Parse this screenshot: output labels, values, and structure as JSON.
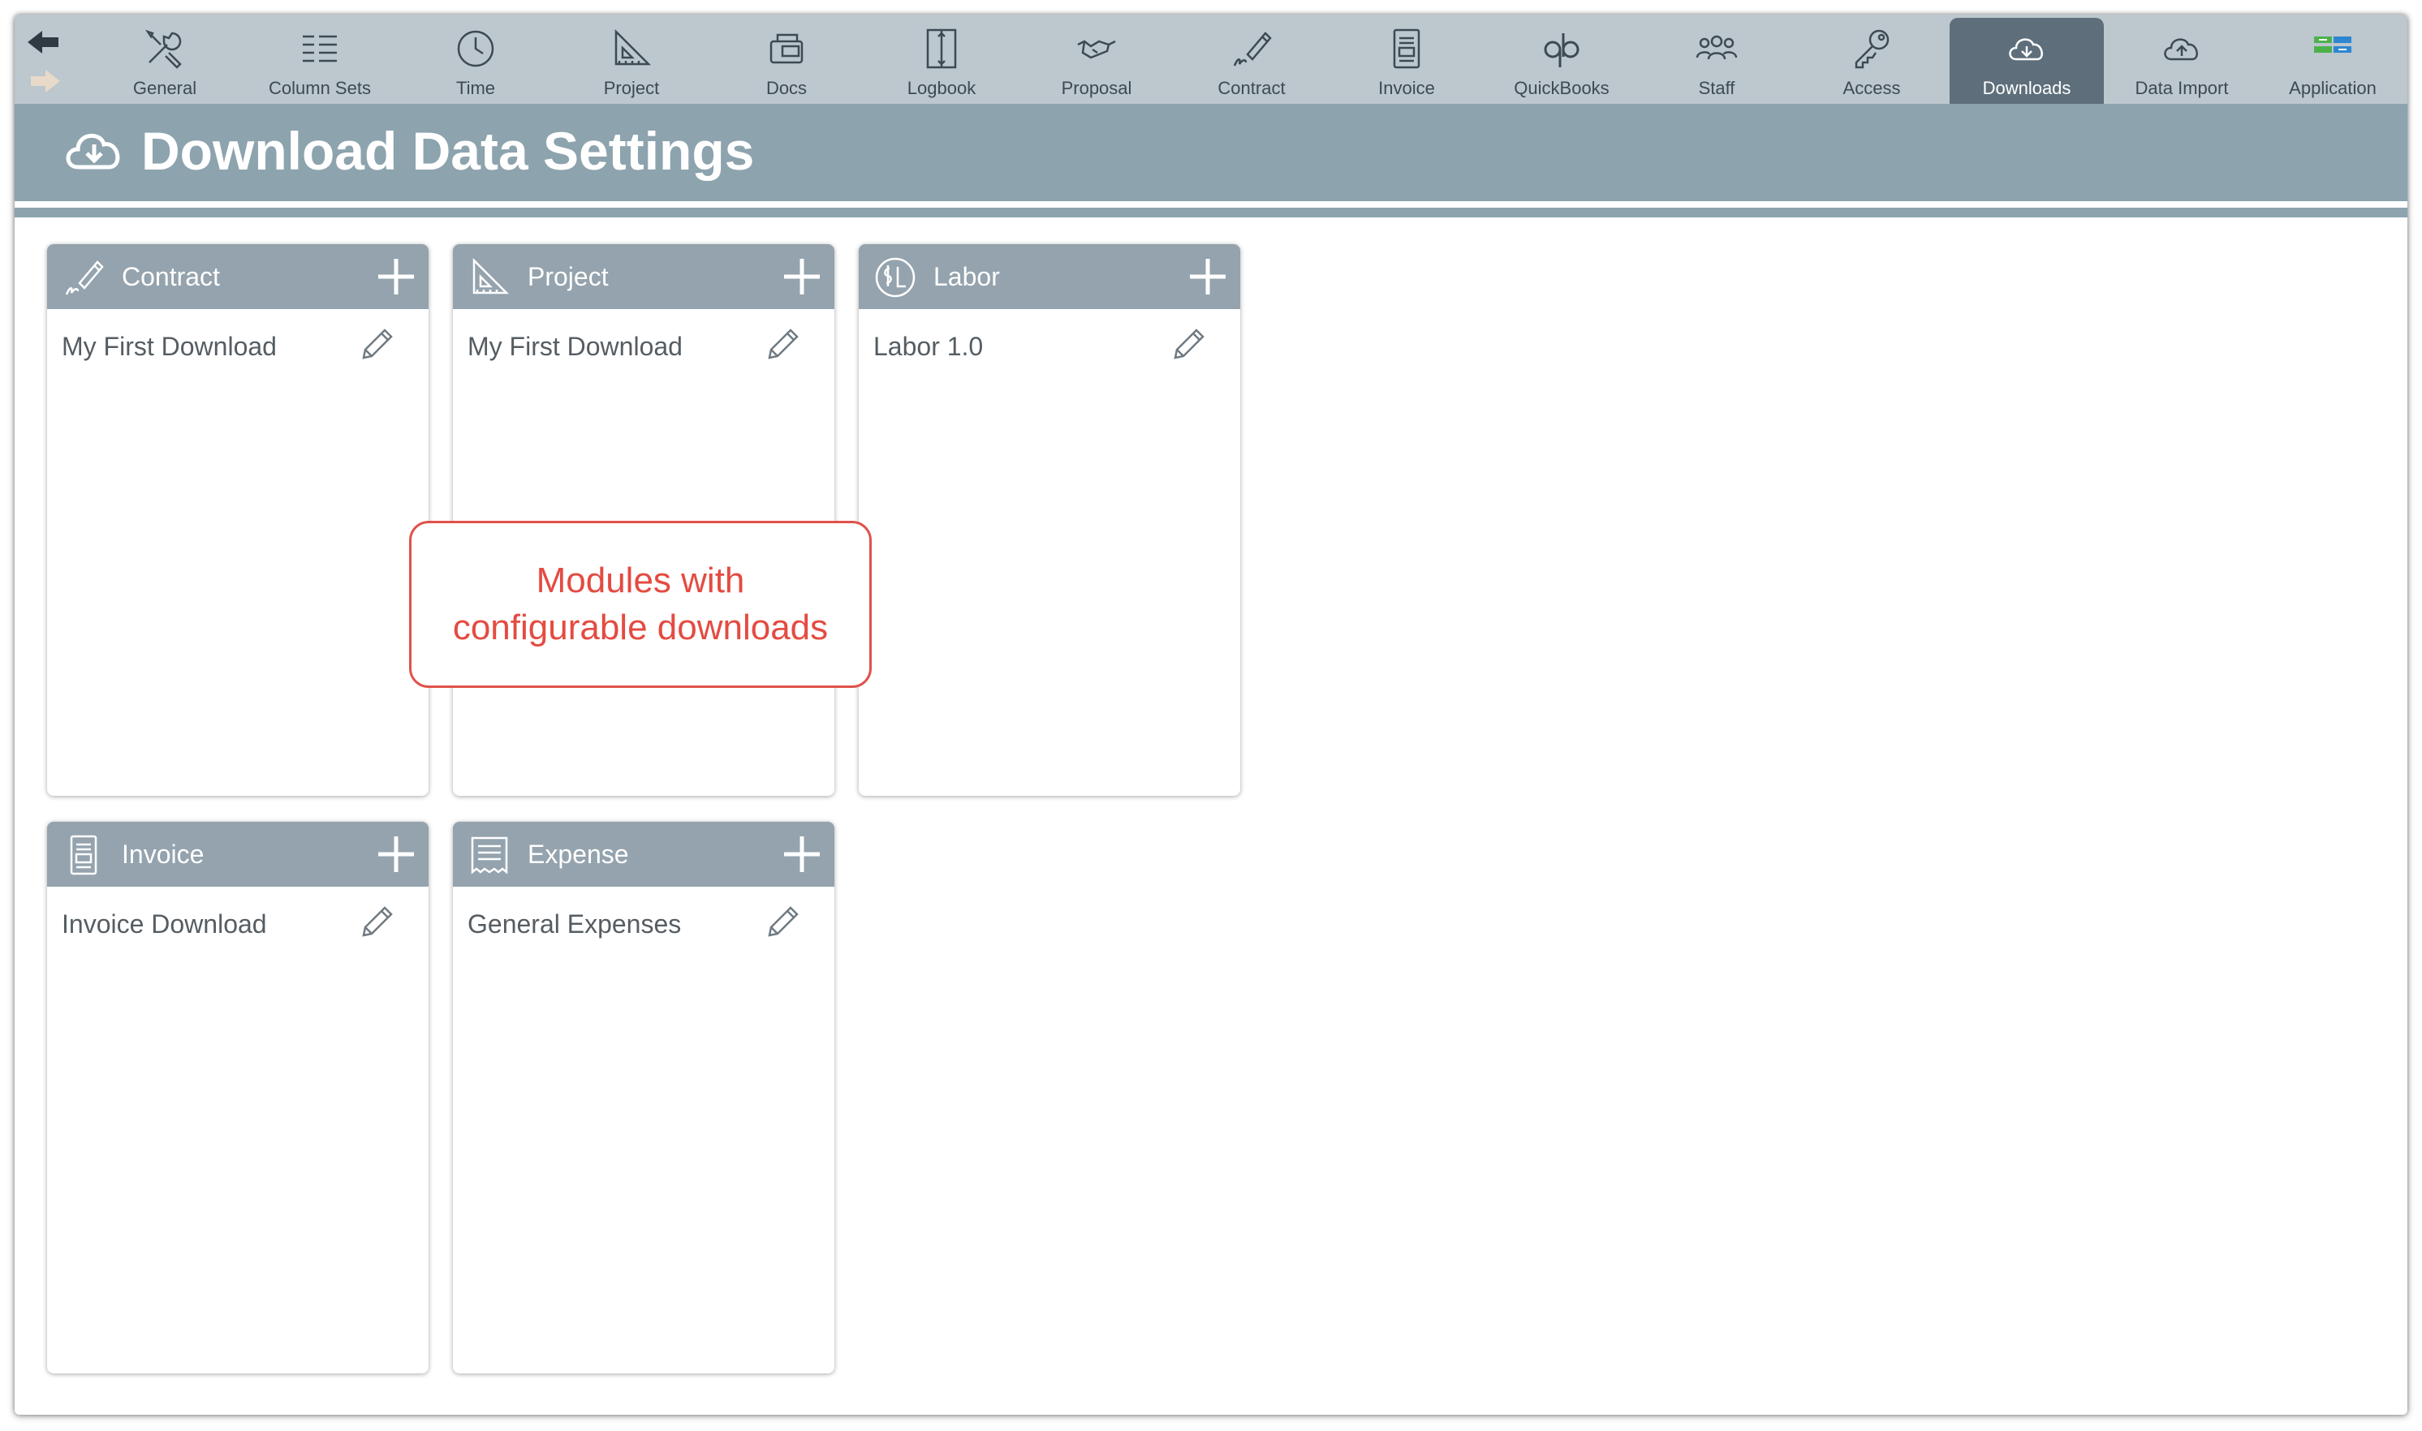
{
  "toolbar": {
    "tabs": [
      {
        "label": "General",
        "icon": "tools-icon"
      },
      {
        "label": "Column Sets",
        "icon": "column-sets-icon"
      },
      {
        "label": "Time",
        "icon": "clock-icon"
      },
      {
        "label": "Project",
        "icon": "triangle-ruler-icon"
      },
      {
        "label": "Docs",
        "icon": "docs-icon"
      },
      {
        "label": "Logbook",
        "icon": "logbook-icon"
      },
      {
        "label": "Proposal",
        "icon": "handshake-icon"
      },
      {
        "label": "Contract",
        "icon": "pen-signature-icon"
      },
      {
        "label": "Invoice",
        "icon": "invoice-icon"
      },
      {
        "label": "QuickBooks",
        "icon": "quickbooks-icon"
      },
      {
        "label": "Staff",
        "icon": "staff-icon"
      },
      {
        "label": "Access",
        "icon": "key-icon"
      },
      {
        "label": "Downloads",
        "icon": "cloud-download-icon",
        "active": true
      },
      {
        "label": "Data Import",
        "icon": "cloud-upload-icon"
      },
      {
        "label": "Application",
        "icon": "application-icon"
      }
    ]
  },
  "header": {
    "title": "Download Data Settings",
    "icon": "cloud-download-icon"
  },
  "modules": [
    {
      "title": "Contract",
      "icon": "pen-signature-icon",
      "items": [
        "My First Download"
      ]
    },
    {
      "title": "Project",
      "icon": "triangle-ruler-icon",
      "items": [
        "My First Download"
      ]
    },
    {
      "title": "Labor",
      "icon": "labor-dollar-icon",
      "items": [
        "Labor 1.0"
      ]
    },
    {
      "title": "Invoice",
      "icon": "invoice-icon",
      "items": [
        "Invoice Download"
      ]
    },
    {
      "title": "Expense",
      "icon": "receipt-icon",
      "items": [
        "General Expenses"
      ]
    }
  ],
  "callout": {
    "line1": "Modules with",
    "line2": "configurable downloads"
  },
  "colors": {
    "toolbar_bg": "#bcc7ce",
    "active_tab": "#5e6f7b",
    "header_bg": "#8da3ae",
    "card_head": "#94a3ad",
    "callout": "#e44b41"
  }
}
